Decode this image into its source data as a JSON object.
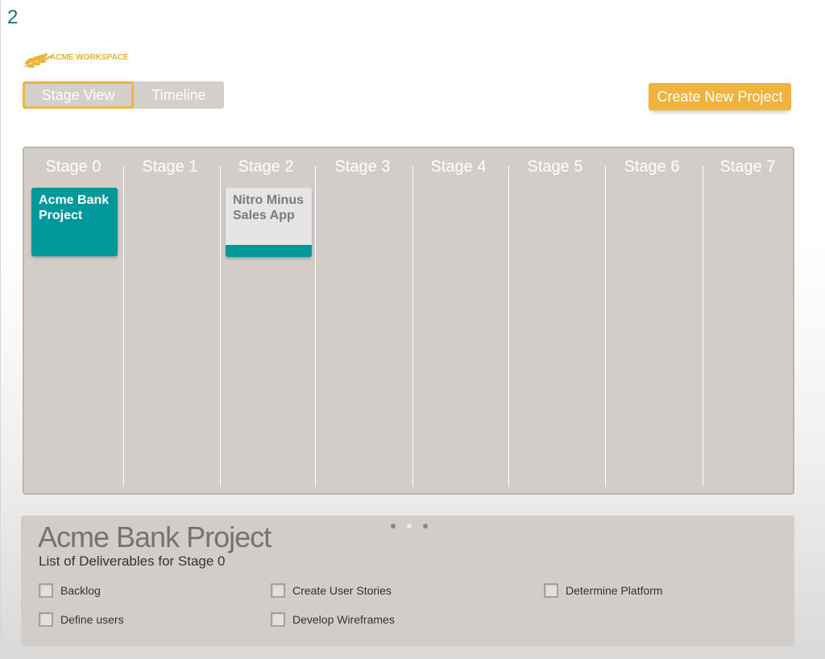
{
  "slide_number": "2",
  "brand": {
    "logo_text": "ACME WORKSPACE",
    "logo_icon": "laurel-leaf-icon",
    "accent_color": "#f0b43e",
    "teal_color": "#00989a"
  },
  "toolbar": {
    "stage_view_label": "Stage View",
    "timeline_label": "Timeline",
    "active_view": "Stage View",
    "create_button_label": "Create New Project"
  },
  "stages": [
    {
      "label": "Stage 0"
    },
    {
      "label": "Stage 1"
    },
    {
      "label": "Stage 2"
    },
    {
      "label": "Stage 3"
    },
    {
      "label": "Stage 4"
    },
    {
      "label": "Stage 5"
    },
    {
      "label": "Stage 6"
    },
    {
      "label": "Stage 7"
    }
  ],
  "projects": [
    {
      "name": "Acme Bank Project",
      "stage": "Stage 0",
      "selected": true
    },
    {
      "name": "Nitro Minus Sales App",
      "stage": "Stage 2",
      "selected": false
    }
  ],
  "detail": {
    "title": "Acme Bank Project",
    "subtitle": "List of Deliverables for Stage 0",
    "page_dots": 3,
    "active_dot": 2,
    "deliverables": [
      {
        "label": "Backlog",
        "checked": false
      },
      {
        "label": "Create User Stories",
        "checked": false
      },
      {
        "label": "Determine Platform",
        "checked": false
      },
      {
        "label": "Define users",
        "checked": false
      },
      {
        "label": "Develop Wireframes",
        "checked": false
      }
    ]
  }
}
